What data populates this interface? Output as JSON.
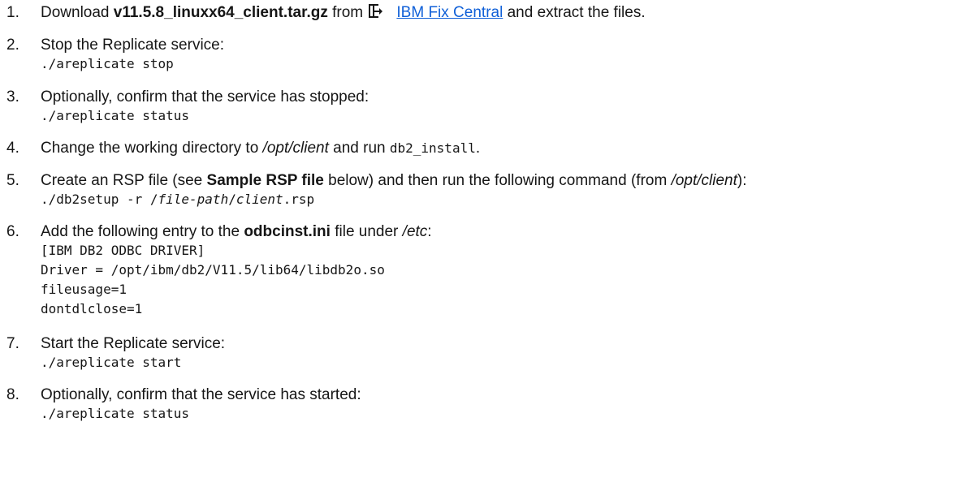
{
  "steps": [
    {
      "num": "1.",
      "prefix": "Download ",
      "filename": "v11.5.8_linuxx64_client.tar.gz",
      "from": " from ",
      "icon": "external-link-icon",
      "link_text": "IBM Fix Central",
      "suffix": " and extract the files."
    },
    {
      "num": "2.",
      "text": "Stop the Replicate service:",
      "code": "./areplicate stop"
    },
    {
      "num": "3.",
      "text": "Optionally, confirm that the service has stopped:",
      "code": "./areplicate status"
    },
    {
      "num": "4.",
      "prefix": "Change the working directory to ",
      "path": "/opt/client",
      "middle": " and run ",
      "command": "db2_install",
      "suffix": "."
    },
    {
      "num": "5.",
      "prefix": "Create an RSP file (see ",
      "bold": "Sample RSP file",
      "middle": " below) and then run the following command (from ",
      "path": "/opt/client",
      "suffix": "):",
      "code_prefix": "./db2setup -r /",
      "code_var": "file-path",
      "code_slash": "/",
      "code_var2": "client",
      "code_suffix": ".rsp"
    },
    {
      "num": "6.",
      "prefix": "Add the following entry to the ",
      "bold": "odbcinst.ini",
      "middle": " file under ",
      "path": "/etc",
      "suffix": ":",
      "code_lines": [
        "[IBM DB2 ODBC DRIVER]",
        "Driver = /opt/ibm/db2/V11.5/lib64/libdb2o.so",
        "fileusage=1",
        "dontdlclose=1"
      ]
    },
    {
      "num": "7.",
      "text": "Start the Replicate service:",
      "code": "./areplicate start"
    },
    {
      "num": "8.",
      "text": "Optionally, confirm that the service has started:",
      "code": "./areplicate status"
    }
  ]
}
